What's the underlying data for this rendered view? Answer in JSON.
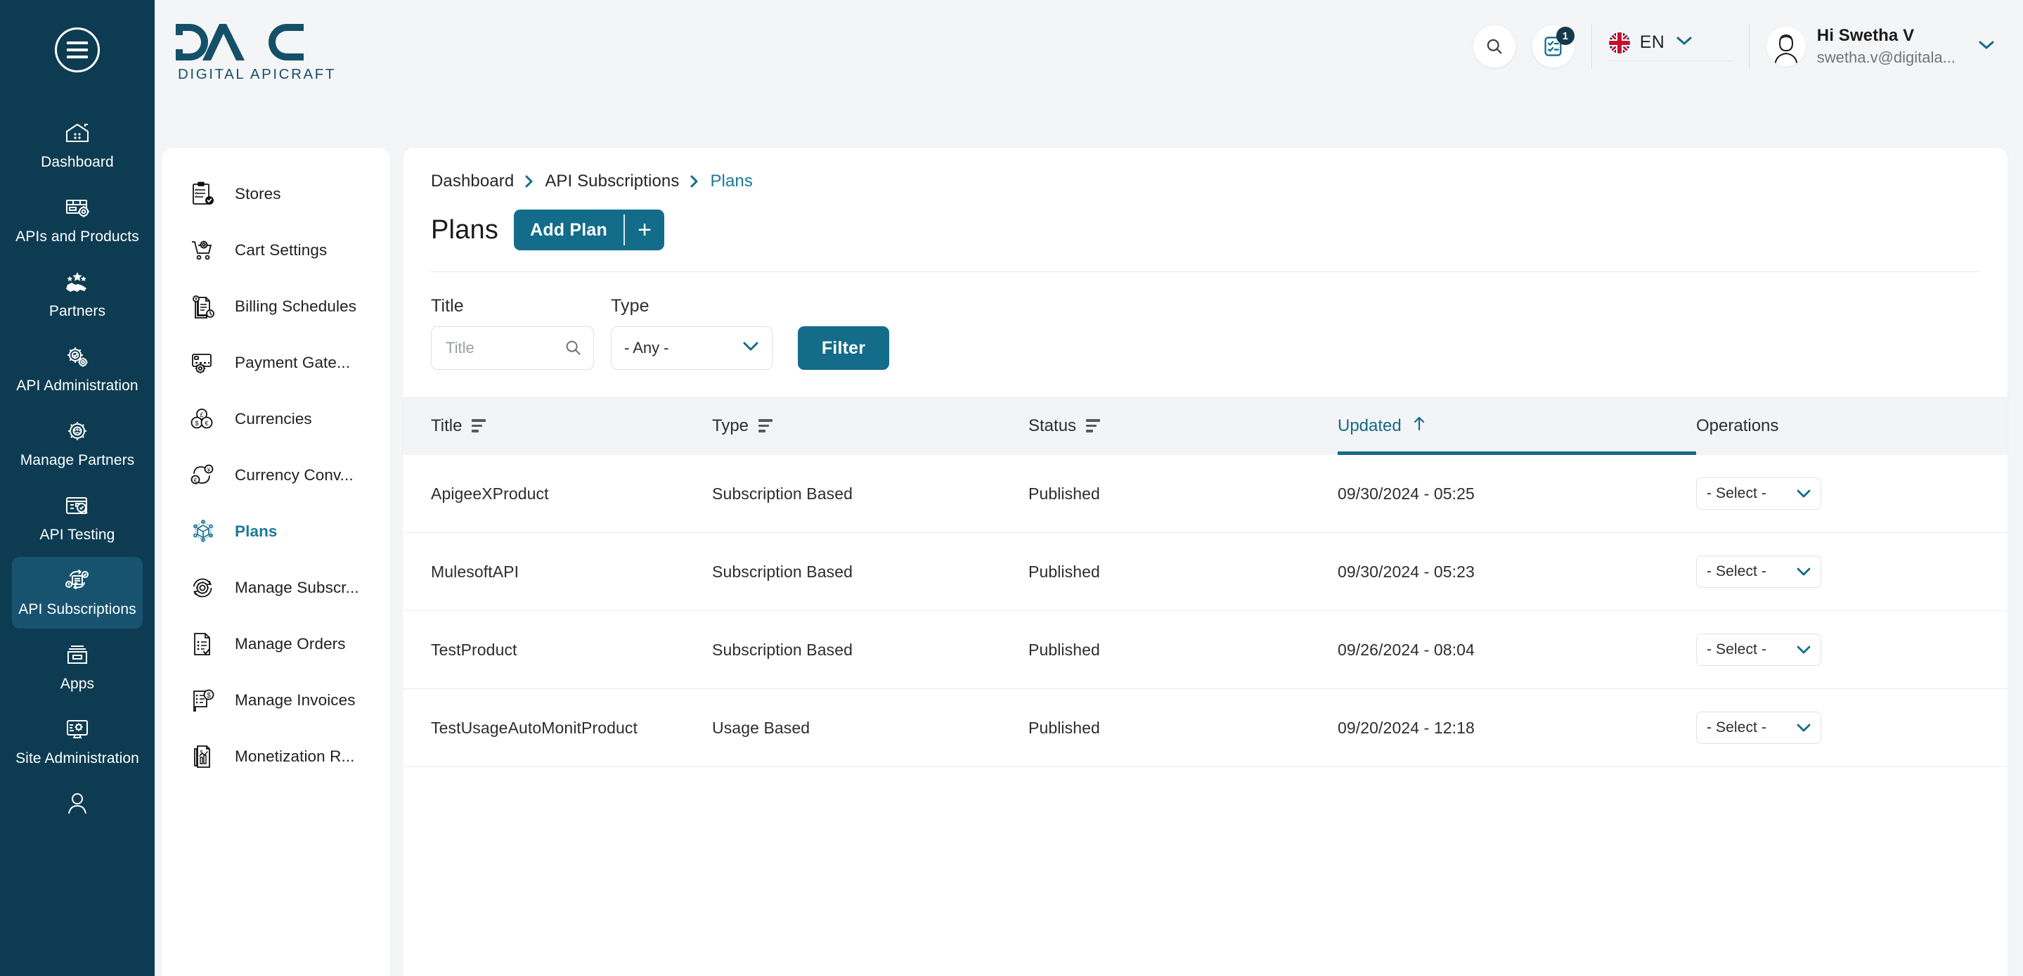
{
  "brand": {
    "mark": "DAC",
    "subtitle": "DIGITAL APICRAFT"
  },
  "header": {
    "search_icon": "search-icon",
    "tasks_icon": "checklist-icon",
    "notification_count": "1",
    "language": {
      "code": "EN",
      "flag": "uk-flag"
    },
    "user": {
      "greeting": "Hi Swetha V",
      "email": "swetha.v@digitala..."
    }
  },
  "primary_nav": {
    "menu_icon": "hamburger-icon",
    "items": [
      {
        "label": "Dashboard",
        "icon": "home-dashboard-icon",
        "active": false
      },
      {
        "label": "APIs and Products",
        "icon": "api-products-icon",
        "active": false
      },
      {
        "label": "Partners",
        "icon": "handshake-stars-icon",
        "active": false
      },
      {
        "label": "API Administration",
        "icon": "gear-check-icon",
        "active": false
      },
      {
        "label": "Manage Partners",
        "icon": "gear-people-icon",
        "active": false
      },
      {
        "label": "API Testing",
        "icon": "test-search-icon",
        "active": false
      },
      {
        "label": "API Subscriptions",
        "icon": "subscription-cycle-icon",
        "active": true
      },
      {
        "label": "Apps",
        "icon": "archive-box-icon",
        "active": false
      },
      {
        "label": "Site Administration",
        "icon": "monitor-gear-icon",
        "active": false
      },
      {
        "label": "",
        "icon": "user-gear-icon",
        "active": false
      }
    ]
  },
  "sub_nav": {
    "items": [
      {
        "label": "Stores",
        "icon": "clipboard-check-icon",
        "active": false
      },
      {
        "label": "Cart Settings",
        "icon": "cart-gear-icon",
        "active": false
      },
      {
        "label": "Billing Schedules",
        "icon": "billing-docs-icon",
        "active": false
      },
      {
        "label": "Payment Gate...",
        "icon": "card-gear-icon",
        "active": false
      },
      {
        "label": "Currencies",
        "icon": "coins-icon",
        "active": false
      },
      {
        "label": "Currency Conv...",
        "icon": "currency-convert-icon",
        "active": false
      },
      {
        "label": "Plans",
        "icon": "plan-cube-icon",
        "active": true
      },
      {
        "label": "Manage Subscr...",
        "icon": "subscription-gear-icon",
        "active": false
      },
      {
        "label": "Manage Orders",
        "icon": "orders-doc-icon",
        "active": false
      },
      {
        "label": "Manage Invoices",
        "icon": "invoice-dollar-icon",
        "active": false
      },
      {
        "label": "Monetization R...",
        "icon": "monetization-report-icon",
        "active": false
      }
    ]
  },
  "breadcrumb": [
    {
      "label": "Dashboard",
      "current": false
    },
    {
      "label": "API Subscriptions",
      "current": false
    },
    {
      "label": "Plans",
      "current": true
    }
  ],
  "page": {
    "title": "Plans",
    "add_button": {
      "label": "Add Plan",
      "plus": "+"
    }
  },
  "filters": {
    "title_label": "Title",
    "title_placeholder": "Title",
    "title_value": "",
    "type_label": "Type",
    "type_selected": "- Any -",
    "type_options": [
      "- Any -",
      "Subscription Based",
      "Usage Based"
    ],
    "filter_button": "Filter"
  },
  "table": {
    "columns": [
      {
        "key": "title",
        "label": "Title",
        "sortable": true,
        "sorted": false
      },
      {
        "key": "type",
        "label": "Type",
        "sortable": true,
        "sorted": false
      },
      {
        "key": "status",
        "label": "Status",
        "sortable": true,
        "sorted": false
      },
      {
        "key": "updated",
        "label": "Updated",
        "sortable": true,
        "sorted": true,
        "direction": "asc"
      },
      {
        "key": "operations",
        "label": "Operations",
        "sortable": false,
        "sorted": false
      }
    ],
    "operation_placeholder": "- Select -",
    "rows": [
      {
        "title": "ApigeeXProduct",
        "type": "Subscription Based",
        "status": "Published",
        "updated": "09/30/2024 - 05:25",
        "operation": "- Select -"
      },
      {
        "title": "MulesoftAPI",
        "type": "Subscription Based",
        "status": "Published",
        "updated": "09/30/2024 - 05:23",
        "operation": "- Select -"
      },
      {
        "title": "TestProduct",
        "type": "Subscription Based",
        "status": "Published",
        "updated": "09/26/2024 - 08:04",
        "operation": "- Select -"
      },
      {
        "title": "TestUsageAutoMonitProduct",
        "type": "Usage Based",
        "status": "Published",
        "updated": "09/20/2024 - 12:18",
        "operation": "- Select -"
      }
    ]
  },
  "colors": {
    "sidebar_bg": "#0d3c52",
    "sidebar_active": "#17536e",
    "accent": "#136c8a",
    "link": "#1a7a96",
    "page_bg": "#f4f5f6",
    "card_bg": "#ffffff",
    "table_head_bg": "#f3f4f5",
    "badge_bg": "#16384c"
  }
}
